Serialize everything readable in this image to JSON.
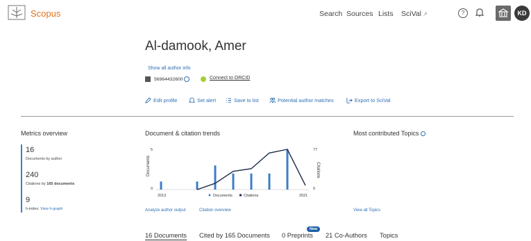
{
  "header": {
    "brand": "Scopus",
    "nav": [
      {
        "label": "Search"
      },
      {
        "label": "Sources"
      },
      {
        "label": "Lists"
      },
      {
        "label": "SciVal"
      }
    ],
    "scival_ext": "↗",
    "help_glyph": "?",
    "avatar_initials": "KD"
  },
  "author": {
    "name": "Al-damook, Amer",
    "show_info": "Show all author info",
    "author_id": "56964432600",
    "orcid_link": "Connect to ORCID"
  },
  "actions": [
    {
      "label": "Edit profile",
      "icon": "pencil-icon"
    },
    {
      "label": "Set alert",
      "icon": "bell-icon"
    },
    {
      "label": "Save to list",
      "icon": "list-icon"
    },
    {
      "label": "Potential author matches",
      "icon": "people-icon"
    },
    {
      "label": "Export to SciVal",
      "icon": "export-icon"
    }
  ],
  "metrics": {
    "title": "Metrics overview",
    "documents": {
      "value": "16",
      "label": "Documents by author"
    },
    "citations": {
      "value": "240",
      "label_prefix": "Citations by ",
      "label_bold": "165 documents"
    },
    "hindex": {
      "value": "9",
      "label": "h-index:",
      "link": "View h-graph"
    }
  },
  "trends": {
    "title": "Document & citation trends",
    "analyze_link": "Analyze author output",
    "citation_link": "Citation overview"
  },
  "topics": {
    "title": "Most contributed Topics",
    "view_all": "View all Topics"
  },
  "chart_data": {
    "type": "bar",
    "title": "Document & citation trends",
    "x_start_label": "2013",
    "x_end_label": "2021",
    "ylabel_left": "Documents",
    "ylabel_right": "Citations",
    "yleft_ticks": [
      "5",
      "0"
    ],
    "yright_ticks": [
      "77",
      "0"
    ],
    "yleft_range": [
      0,
      5
    ],
    "yright_range": [
      0,
      77
    ],
    "categories": [
      "2013",
      "2014",
      "2015",
      "2016",
      "2017",
      "2018",
      "2019",
      "2020",
      "2021"
    ],
    "series": [
      {
        "name": "Documents",
        "type": "bar",
        "color": "#3d7ec9",
        "values": [
          1,
          0,
          1,
          3,
          2,
          2,
          2,
          5,
          0
        ]
      },
      {
        "name": "Citations",
        "type": "line",
        "color": "#1c2b4a",
        "values": [
          null,
          null,
          0,
          12,
          35,
          40,
          70,
          77,
          8
        ]
      }
    ],
    "legend_position": "bottom"
  },
  "tabs": [
    {
      "label": "16 Documents"
    },
    {
      "label": "Cited by 165 Documents"
    },
    {
      "label": "0 Preprints"
    },
    {
      "label": "21 Co-Authors"
    },
    {
      "label": "Topics"
    }
  ],
  "new_badge": "New",
  "colors": {
    "brand": "#e9711c",
    "link": "#2f6fb5",
    "bar": "#3d7ec9",
    "line": "#1c2b4a"
  }
}
